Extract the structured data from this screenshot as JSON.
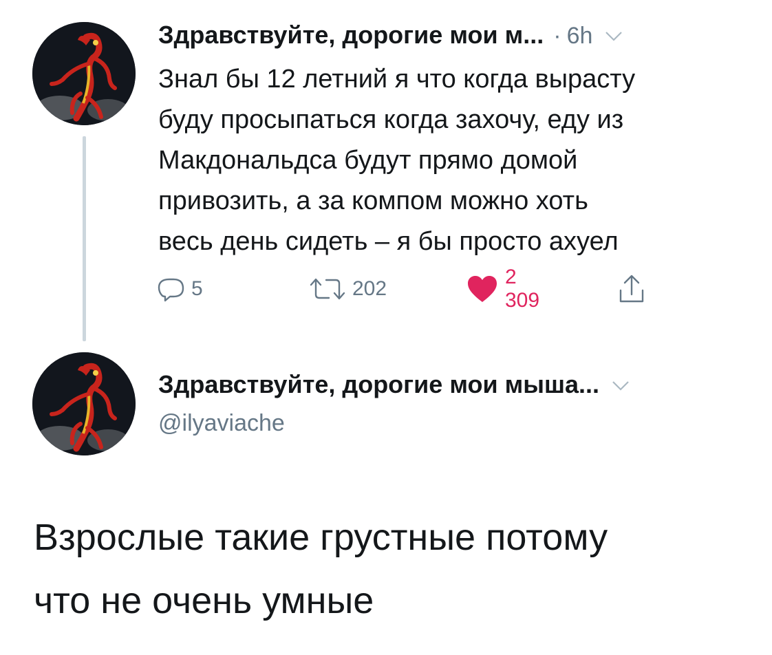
{
  "tweet": {
    "display_name": "Здравствуйте, дорогие мои м...",
    "time_separator": "·",
    "timestamp": "6h",
    "text": "Знал бы 12 летний я что когда вырасту\nбуду просыпаться когда захочу, еду из\nМакдональдса будут прямо домой\nпривозить, а за компом можно хоть\nвесь день сидеть – я бы просто ахуел",
    "actions": {
      "reply_count": "5",
      "retweet_count": "202",
      "like_count": "2 309"
    },
    "avatar_icon": "cartoon-dragon-avatar",
    "liked": true
  },
  "profile": {
    "display_name": "Здравствуйте, дорогие мои мыша...",
    "handle": "@ilyaviache",
    "avatar_icon": "cartoon-dragon-avatar"
  },
  "caption": {
    "text": "Взрослые такие грустные потому\nчто не очень умные"
  },
  "colors": {
    "text_primary": "#14171a",
    "text_secondary": "#657786",
    "like": "#e0245e",
    "thread_line": "#ccd6dd",
    "background": "#ffffff"
  }
}
